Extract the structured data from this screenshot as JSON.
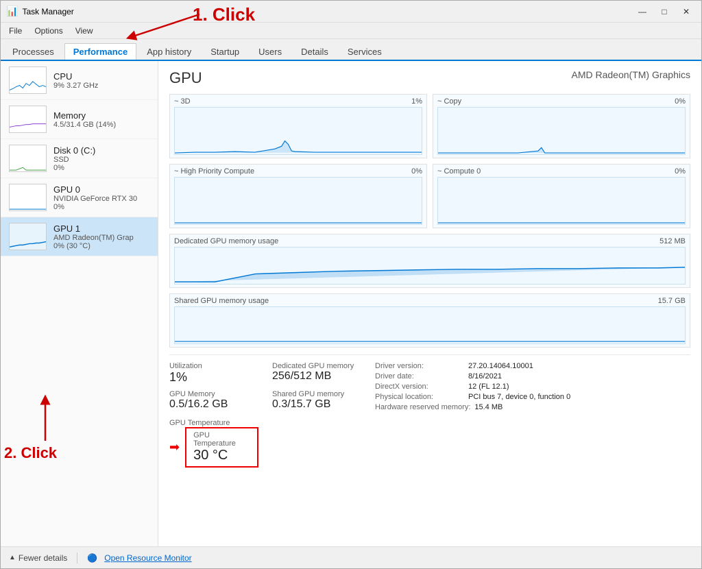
{
  "window": {
    "title": "Task Manager",
    "icon": "⚙"
  },
  "titlebar": {
    "minimize": "—",
    "maximize": "□",
    "close": "✕"
  },
  "menubar": {
    "items": [
      "File",
      "Options",
      "View"
    ]
  },
  "tabs": {
    "items": [
      "Processes",
      "Performance",
      "App history",
      "Startup",
      "Users",
      "Details",
      "Services"
    ],
    "active": "Performance"
  },
  "sidebar": {
    "items": [
      {
        "id": "cpu",
        "name": "CPU",
        "sub1": "9%  3.27 GHz",
        "sub2": ""
      },
      {
        "id": "memory",
        "name": "Memory",
        "sub1": "4.5/31.4 GB (14%)",
        "sub2": ""
      },
      {
        "id": "disk0",
        "name": "Disk 0 (C:)",
        "sub1": "SSD",
        "sub2": "0%"
      },
      {
        "id": "gpu0",
        "name": "GPU 0",
        "sub1": "NVIDIA GeForce RTX 30",
        "sub2": "0%"
      },
      {
        "id": "gpu1",
        "name": "GPU 1",
        "sub1": "AMD Radeon(TM) Grap",
        "sub2": "0% (30 °C)",
        "active": true
      }
    ]
  },
  "panel": {
    "title": "GPU",
    "subtitle": "AMD Radeon(TM) Graphics",
    "charts": [
      {
        "id": "3d",
        "label": "3D",
        "percent": "1%"
      },
      {
        "id": "copy",
        "label": "Copy",
        "percent": "0%"
      },
      {
        "id": "highpri",
        "label": "High Priority Compute",
        "percent": "0%"
      },
      {
        "id": "compute0",
        "label": "Compute 0",
        "percent": "0%"
      }
    ],
    "wide_charts": [
      {
        "id": "dedicated",
        "label": "Dedicated GPU memory usage",
        "right": "512 MB"
      },
      {
        "id": "shared",
        "label": "Shared GPU memory usage",
        "right": "15.7 GB"
      }
    ],
    "stats": [
      {
        "label": "Utilization",
        "value": "1%",
        "size": "large"
      },
      {
        "label": "Dedicated GPU memory",
        "value": "256/512 MB",
        "size": "medium"
      },
      {
        "label": "Driver version:",
        "value": "27.20.14064.10001",
        "size": "small"
      },
      {
        "label": "Driver date:",
        "value": "8/16/2021",
        "size": "small"
      },
      {
        "label": "GPU Memory",
        "value": "0.5/16.2 GB",
        "size": "medium"
      },
      {
        "label": "Shared GPU memory",
        "value": "0.3/15.7 GB",
        "size": "medium"
      },
      {
        "label": "DirectX version:",
        "value": "12 (FL 12.1)",
        "size": "small"
      },
      {
        "label": "Physical location:",
        "value": "PCI bus 7, device 0, function 0",
        "size": "small"
      },
      {
        "label": "GPU Temperature",
        "value": "30 °C",
        "size": "large"
      },
      {
        "label": "",
        "value": "",
        "size": "small"
      },
      {
        "label": "Hardware reserved memory:",
        "value": "15.4 MB",
        "size": "small"
      }
    ]
  },
  "annotations": {
    "click1": "1. Click",
    "click2": "2. Click"
  },
  "bottombar": {
    "fewer_details": "Fewer details",
    "open_resource": "Open Resource Monitor"
  }
}
